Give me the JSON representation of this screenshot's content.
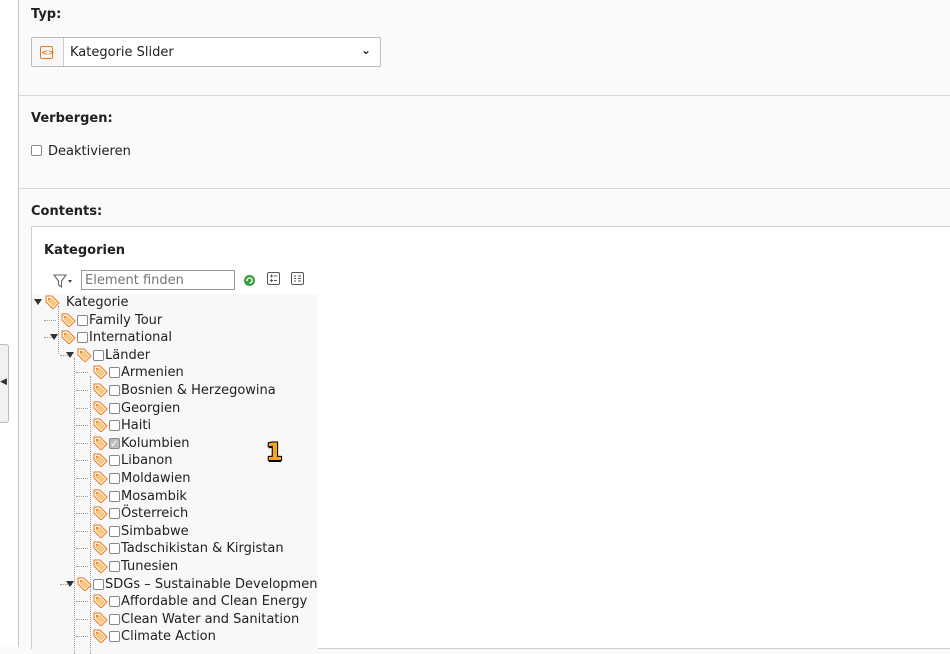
{
  "type_section": {
    "label": "Typ:",
    "select_value": "Kategorie Slider"
  },
  "hide_section": {
    "label": "Verbergen:",
    "checkbox_label": "Deaktivieren",
    "checked": false
  },
  "contents_section": {
    "label": "Contents:"
  },
  "categories": {
    "label": "Kategorien",
    "search_placeholder": "Element finden",
    "tree": [
      {
        "label": "Kategorie",
        "level": 0,
        "expanded": true,
        "has_checkbox": false,
        "checked": false
      },
      {
        "label": "Family Tour",
        "level": 1,
        "expanded": false,
        "has_checkbox": true,
        "checked": false
      },
      {
        "label": "International",
        "level": 1,
        "expanded": true,
        "has_checkbox": true,
        "checked": false
      },
      {
        "label": "Länder",
        "level": 2,
        "expanded": true,
        "has_checkbox": true,
        "checked": false
      },
      {
        "label": "Armenien",
        "level": 3,
        "has_checkbox": true,
        "checked": false
      },
      {
        "label": "Bosnien & Herzegowina",
        "level": 3,
        "has_checkbox": true,
        "checked": false
      },
      {
        "label": "Georgien",
        "level": 3,
        "has_checkbox": true,
        "checked": false
      },
      {
        "label": "Haiti",
        "level": 3,
        "has_checkbox": true,
        "checked": false
      },
      {
        "label": "Kolumbien",
        "level": 3,
        "has_checkbox": true,
        "checked": true
      },
      {
        "label": "Libanon",
        "level": 3,
        "has_checkbox": true,
        "checked": false
      },
      {
        "label": "Moldawien",
        "level": 3,
        "has_checkbox": true,
        "checked": false
      },
      {
        "label": "Mosambik",
        "level": 3,
        "has_checkbox": true,
        "checked": false
      },
      {
        "label": "Österreich",
        "level": 3,
        "has_checkbox": true,
        "checked": false
      },
      {
        "label": "Simbabwe",
        "level": 3,
        "has_checkbox": true,
        "checked": false
      },
      {
        "label": "Tadschikistan & Kirgistan",
        "level": 3,
        "has_checkbox": true,
        "checked": false
      },
      {
        "label": "Tunesien",
        "level": 3,
        "has_checkbox": true,
        "checked": false
      },
      {
        "label": "SDGs – Sustainable Developmen",
        "level": 2,
        "expanded": true,
        "has_checkbox": true,
        "checked": false
      },
      {
        "label": "Affordable and Clean Energy",
        "level": 3,
        "has_checkbox": true,
        "checked": false
      },
      {
        "label": "Clean Water and Sanitation",
        "level": 3,
        "has_checkbox": true,
        "checked": false
      },
      {
        "label": "Climate Action",
        "level": 3,
        "has_checkbox": true,
        "checked": false
      }
    ]
  },
  "annotation_badge": "1",
  "colors": {
    "accent": "#e8771a",
    "badge": "#f6a623"
  },
  "icons": [
    "collapse-arrow-icon",
    "filter-icon",
    "refresh-icon",
    "expand-all-icon",
    "collapse-all-icon",
    "category-tag-icon",
    "content-element-icon",
    "chevron-down-icon"
  ]
}
